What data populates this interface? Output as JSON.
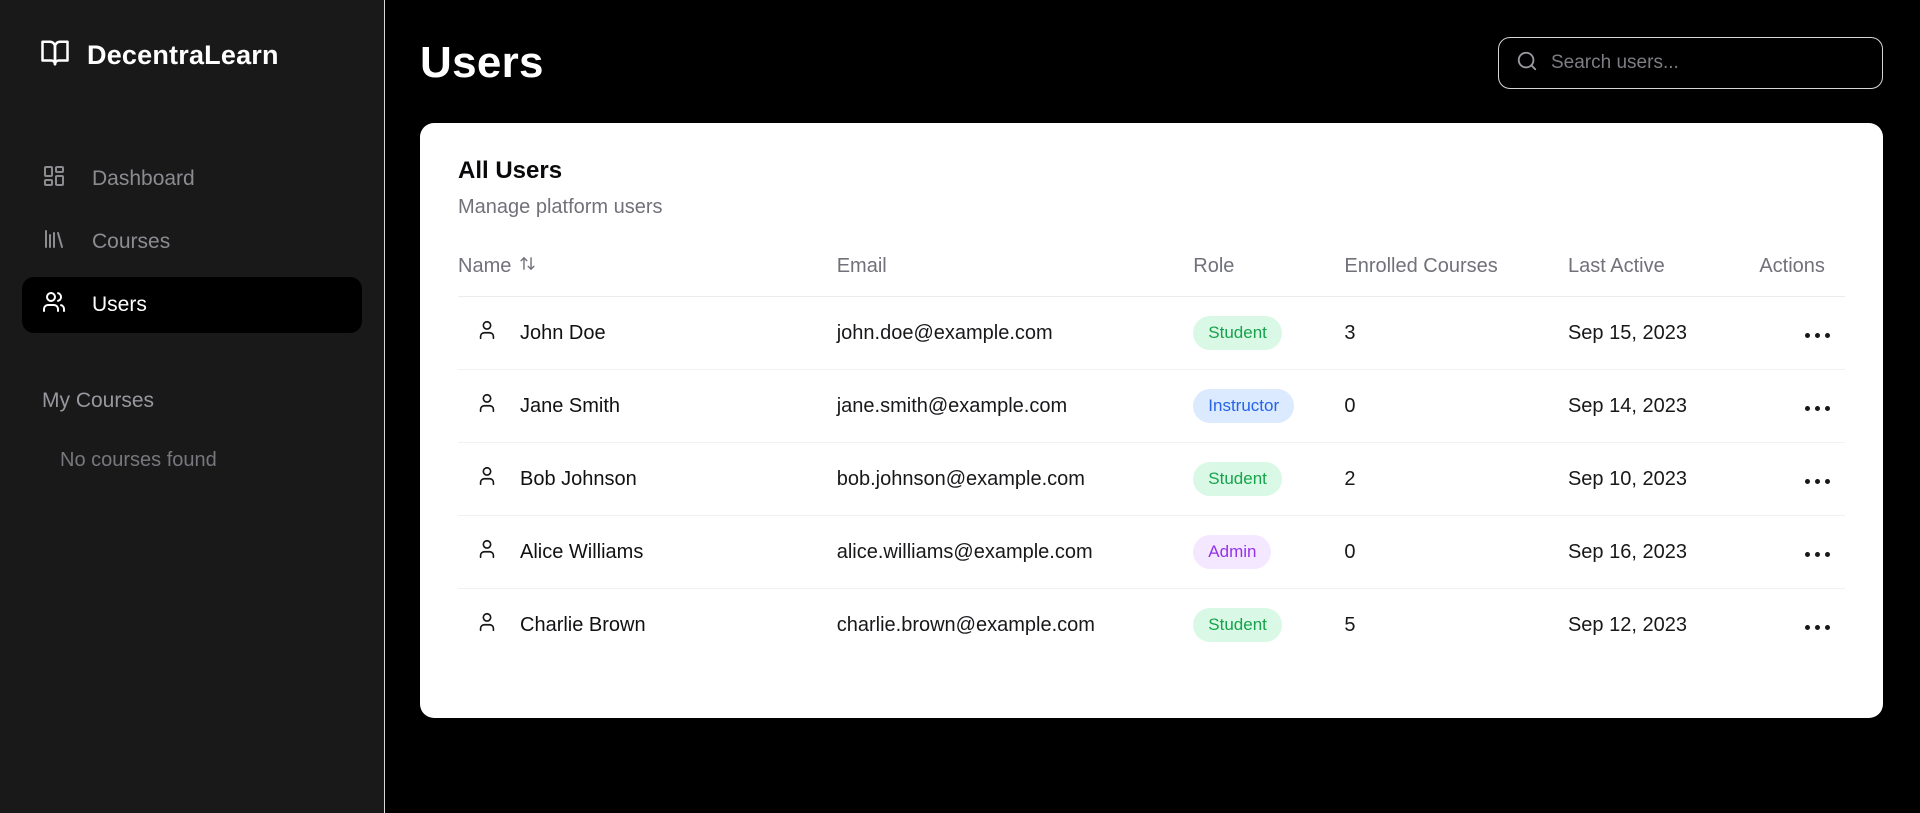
{
  "app": {
    "name": "DecentraLearn"
  },
  "sidebar": {
    "items": [
      {
        "label": "Dashboard",
        "icon": "layout-dashboard-icon",
        "active": false
      },
      {
        "label": "Courses",
        "icon": "library-icon",
        "active": false
      },
      {
        "label": "Users",
        "icon": "users-icon",
        "active": true
      }
    ],
    "section_label": "My Courses",
    "empty_text": "No courses found"
  },
  "header": {
    "title": "Users",
    "search_placeholder": "Search users...",
    "search_value": "",
    "search_icon": "magnifier-icon"
  },
  "card": {
    "title": "All Users",
    "subtitle": "Manage platform users"
  },
  "table": {
    "headers": {
      "name": "Name",
      "email": "Email",
      "role": "Role",
      "enrolled": "Enrolled Courses",
      "last_active": "Last Active",
      "actions": "Actions"
    },
    "sort_column": "Name",
    "sort_icon": "arrow-up-down-icon",
    "row_avatar_icon": "user-icon",
    "row_actions_icon": "ellipsis-icon",
    "rows": [
      {
        "name": "John Doe",
        "email": "john.doe@example.com",
        "role": "Student",
        "enrolled": "3",
        "last_active": "Sep 15, 2023"
      },
      {
        "name": "Jane Smith",
        "email": "jane.smith@example.com",
        "role": "Instructor",
        "enrolled": "0",
        "last_active": "Sep 14, 2023"
      },
      {
        "name": "Bob Johnson",
        "email": "bob.johnson@example.com",
        "role": "Student",
        "enrolled": "2",
        "last_active": "Sep 10, 2023"
      },
      {
        "name": "Alice Williams",
        "email": "alice.williams@example.com",
        "role": "Admin",
        "enrolled": "0",
        "last_active": "Sep 16, 2023"
      },
      {
        "name": "Charlie Brown",
        "email": "charlie.brown@example.com",
        "role": "Student",
        "enrolled": "5",
        "last_active": "Sep 12, 2023"
      }
    ]
  },
  "colors": {
    "sidebar_bg": "#19191a",
    "main_bg": "#000000",
    "card_bg": "#ffffff",
    "active_item_bg": "#000000",
    "muted_text": "#71717a",
    "roles": {
      "Student": {
        "bg": "#d9f9e6",
        "text": "#16a34a"
      },
      "Instructor": {
        "bg": "#dbeafe",
        "text": "#2563eb"
      },
      "Admin": {
        "bg": "#f3e8ff",
        "text": "#9333ea"
      }
    }
  }
}
